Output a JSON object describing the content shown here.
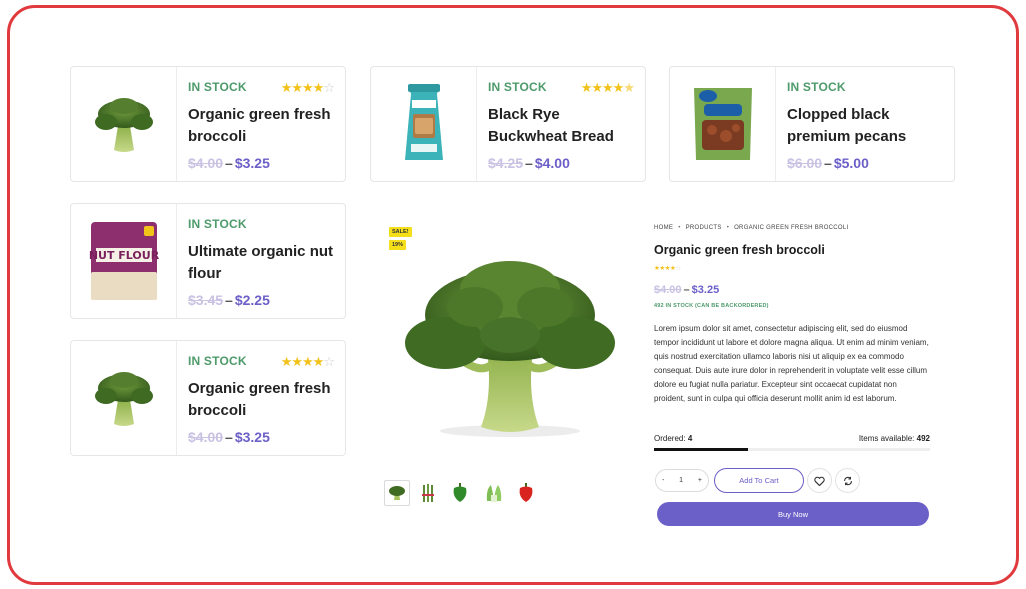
{
  "colors": {
    "frame": "#e0393e",
    "accent": "#6b5fc8",
    "stock": "#4e9a6b",
    "star": "#f3c21a",
    "badge": "#f5df1b"
  },
  "cards": [
    {
      "stock": "IN STOCK",
      "title": "Organic green fresh broccoli",
      "old_price": "$4.00",
      "dash": "–",
      "new_price": "$3.25",
      "rating": 4,
      "image": "broccoli-image"
    },
    {
      "stock": "IN STOCK",
      "title": "Black Rye Buckwheat Bread",
      "old_price": "$4.25",
      "dash": "–",
      "new_price": "$4.00",
      "rating": 4.5,
      "image": "bread-bag-image"
    },
    {
      "stock": "IN STOCK",
      "title": "Clopped black premium pecans",
      "old_price": "$6.00",
      "dash": "–",
      "new_price": "$5.00",
      "rating": 0,
      "image": "pecans-bag-image"
    },
    {
      "stock": "IN STOCK",
      "title": "Ultimate organic nut flour",
      "old_price": "$3.45",
      "dash": "–",
      "new_price": "$2.25",
      "rating": 0,
      "image": "nut-flour-bag-image"
    },
    {
      "stock": "IN STOCK",
      "title": "Organic green fresh broccoli",
      "old_price": "$4.00",
      "dash": "–",
      "new_price": "$3.25",
      "rating": 4,
      "image": "broccoli-image"
    }
  ],
  "detail": {
    "badges": {
      "sale": "SALE!",
      "discount": "19%"
    },
    "breadcrumb": [
      "HOME",
      "PRODUCTS",
      "ORGANIC GREEN FRESH BROCCOLI"
    ],
    "title": "Organic green fresh broccoli",
    "rating": 4,
    "old_price": "$4.00",
    "dash": "–",
    "new_price": "$3.25",
    "stock_text": "492 IN STOCK (CAN BE BACKORDERED)",
    "description": "Lorem ipsum dolor sit amet, consectetur adipiscing elit, sed do eiusmod tempor incididunt ut labore et dolore magna aliqua. Ut enim ad minim veniam, quis nostrud exercitation ullamco laboris nisi ut aliquip ex ea commodo consequat. Duis aute irure dolor in reprehenderit in voluptate velit esse cillum dolore eu fugiat nulla pariatur. Excepteur sint occaecat cupidatat non proident, sunt in culpa qui officia deserunt mollit anim id est laborum.",
    "ordered_label": "Ordered:",
    "ordered_value": "4",
    "available_label": "Items available:",
    "available_value": "492",
    "progress_fraction": 0.34,
    "qty_minus": "-",
    "qty_value": "1",
    "qty_plus": "+",
    "add_to_cart": "Add To Cart",
    "wishlist_icon": "heart-icon",
    "compare_icon": "refresh-icon",
    "buy_now": "Buy Now",
    "gallery": [
      "broccoli-thumb",
      "asparagus-thumb",
      "green-pepper-thumb",
      "bok-choy-thumb",
      "red-pepper-thumb"
    ]
  }
}
